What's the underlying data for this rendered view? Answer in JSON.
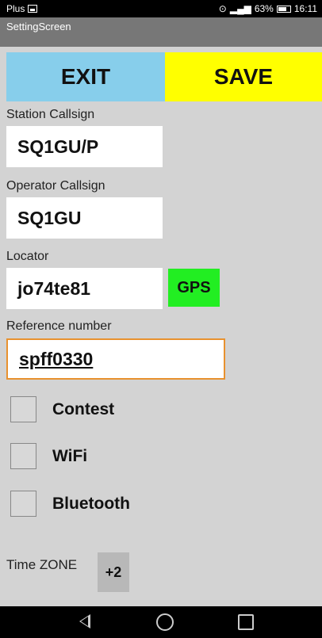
{
  "status_bar": {
    "carrier": "Plus",
    "battery": "63%",
    "time": "16:11",
    "icons": [
      "image-icon",
      "location-icon",
      "signal-icon",
      "battery-icon"
    ]
  },
  "app": {
    "title": "SettingScreen"
  },
  "buttons": {
    "exit_label": "EXIT",
    "save_label": "SAVE",
    "gps_label": "GPS"
  },
  "fields": {
    "station_callsign": {
      "label": "Station Callsign",
      "value": "SQ1GU/P"
    },
    "operator_callsign": {
      "label": "Operator Callsign",
      "value": "SQ1GU"
    },
    "locator": {
      "label": "Locator",
      "value": "jo74te81"
    },
    "reference_number": {
      "label": "Reference number",
      "value": "spff0330"
    }
  },
  "checkboxes": [
    {
      "label": "Contest",
      "checked": false
    },
    {
      "label": "WiFi",
      "checked": false
    },
    {
      "label": "Bluetooth",
      "checked": false
    }
  ],
  "timezone": {
    "label": "Time ZONE",
    "value": "+2"
  },
  "colors": {
    "exit_bg": "#87ceeb",
    "save_bg": "#ffff00",
    "gps_bg": "#22ee22",
    "focus_border": "#e8912e",
    "screen_bg": "#d3d3d3"
  }
}
